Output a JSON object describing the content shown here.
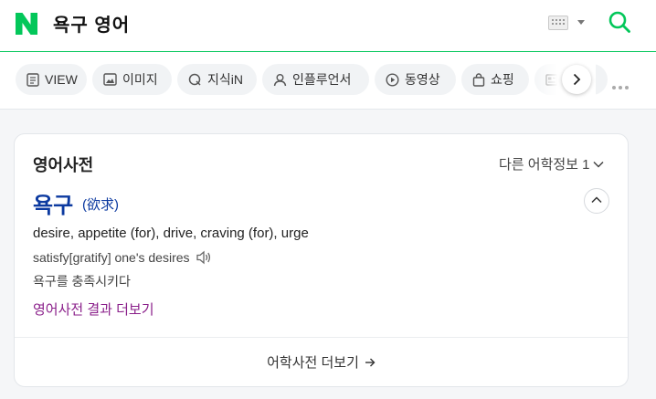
{
  "header": {
    "query": "욕구 영어",
    "brand_color": "#03c75a"
  },
  "tabs": [
    {
      "label": "VIEW",
      "icon": "document-icon"
    },
    {
      "label": "이미지",
      "icon": "image-icon"
    },
    {
      "label": "지식iN",
      "icon": "q-icon"
    },
    {
      "label": "인플루언서",
      "icon": "person-icon"
    },
    {
      "label": "동영상",
      "icon": "play-icon"
    },
    {
      "label": "쇼핑",
      "icon": "bag-icon"
    },
    {
      "label": "",
      "icon": "news-icon"
    }
  ],
  "dictionary": {
    "title": "영어사전",
    "other_info": "다른 어학정보 1",
    "word": "욕구",
    "hanja": "(欲求)",
    "meaning": "desire, appetite (for), drive, craving (for), urge",
    "example_en": "satisfy[gratify] one's desires",
    "example_ko": "욕구를 충족시키다",
    "result_link": "영어사전 결과 더보기",
    "more_link": "어학사전 더보기",
    "word_color": "#0c3aa0",
    "link_color": "#8a1f8a"
  }
}
